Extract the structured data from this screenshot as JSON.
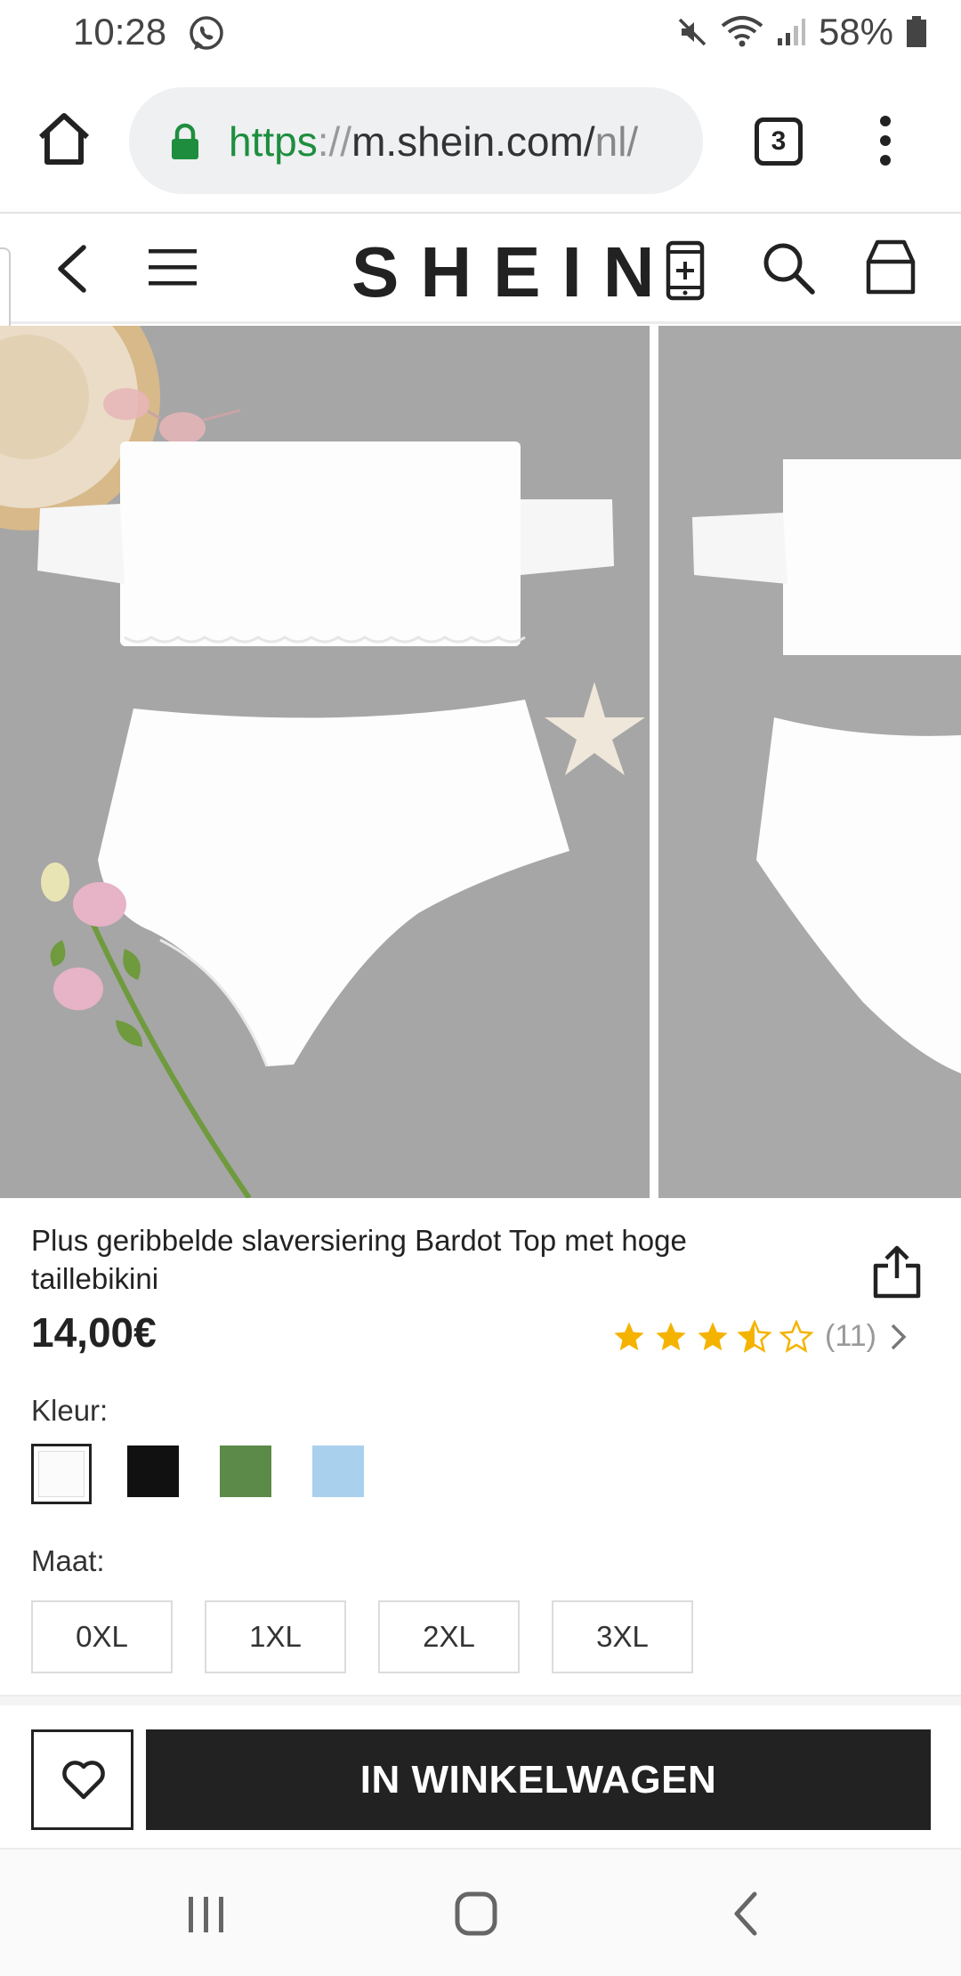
{
  "status_bar": {
    "time": "10:28",
    "battery": "58%",
    "icons": [
      "whatsapp-icon",
      "mute-icon",
      "wifi-icon",
      "signal-icon",
      "battery-icon"
    ]
  },
  "browser": {
    "url_scheme": "https",
    "url_sep": "://",
    "url_host": "m.shein.com/",
    "url_path": "nl/",
    "tab_count": "3"
  },
  "header": {
    "logo": "SHEIN"
  },
  "product": {
    "title": "Plus geribbelde slaversiering Bardot Top met hoge taillebikini",
    "price": "14,00€",
    "rating": 3.5,
    "rating_count": "(11)",
    "color_label": "Kleur:",
    "colors": [
      {
        "name": "white",
        "hex": "#fbfbfb"
      },
      {
        "name": "black",
        "hex": "#111111"
      },
      {
        "name": "green",
        "hex": "#5c8a48"
      },
      {
        "name": "light-blue",
        "hex": "#a9d1ee"
      }
    ],
    "size_label": "Maat:",
    "sizes": [
      "0XL",
      "1XL",
      "2XL",
      "3XL"
    ]
  },
  "actions": {
    "add_to_cart": "IN WINKELWAGEN"
  },
  "colors": {
    "accent": "#222222",
    "star": "#f5b301",
    "lock": "#1e8e3e"
  }
}
